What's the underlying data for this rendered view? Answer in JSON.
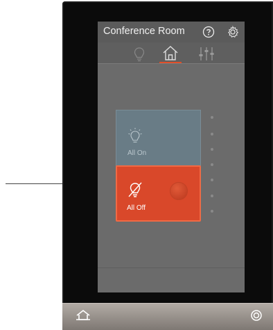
{
  "app": {
    "title": "Conference Room"
  },
  "scenes": [
    {
      "label": "All On",
      "state": "inactive",
      "color": "#697c86"
    },
    {
      "label": "All Off",
      "state": "active",
      "color": "#d9482a"
    }
  ],
  "tabs": [
    {
      "icon": "bulb-icon",
      "active": false
    },
    {
      "icon": "home-icon",
      "active": true
    },
    {
      "icon": "sliders-icon",
      "active": false
    }
  ],
  "colors": {
    "accent": "#e0502a",
    "callout": "#4fb54a"
  },
  "page_dots_count": 7
}
